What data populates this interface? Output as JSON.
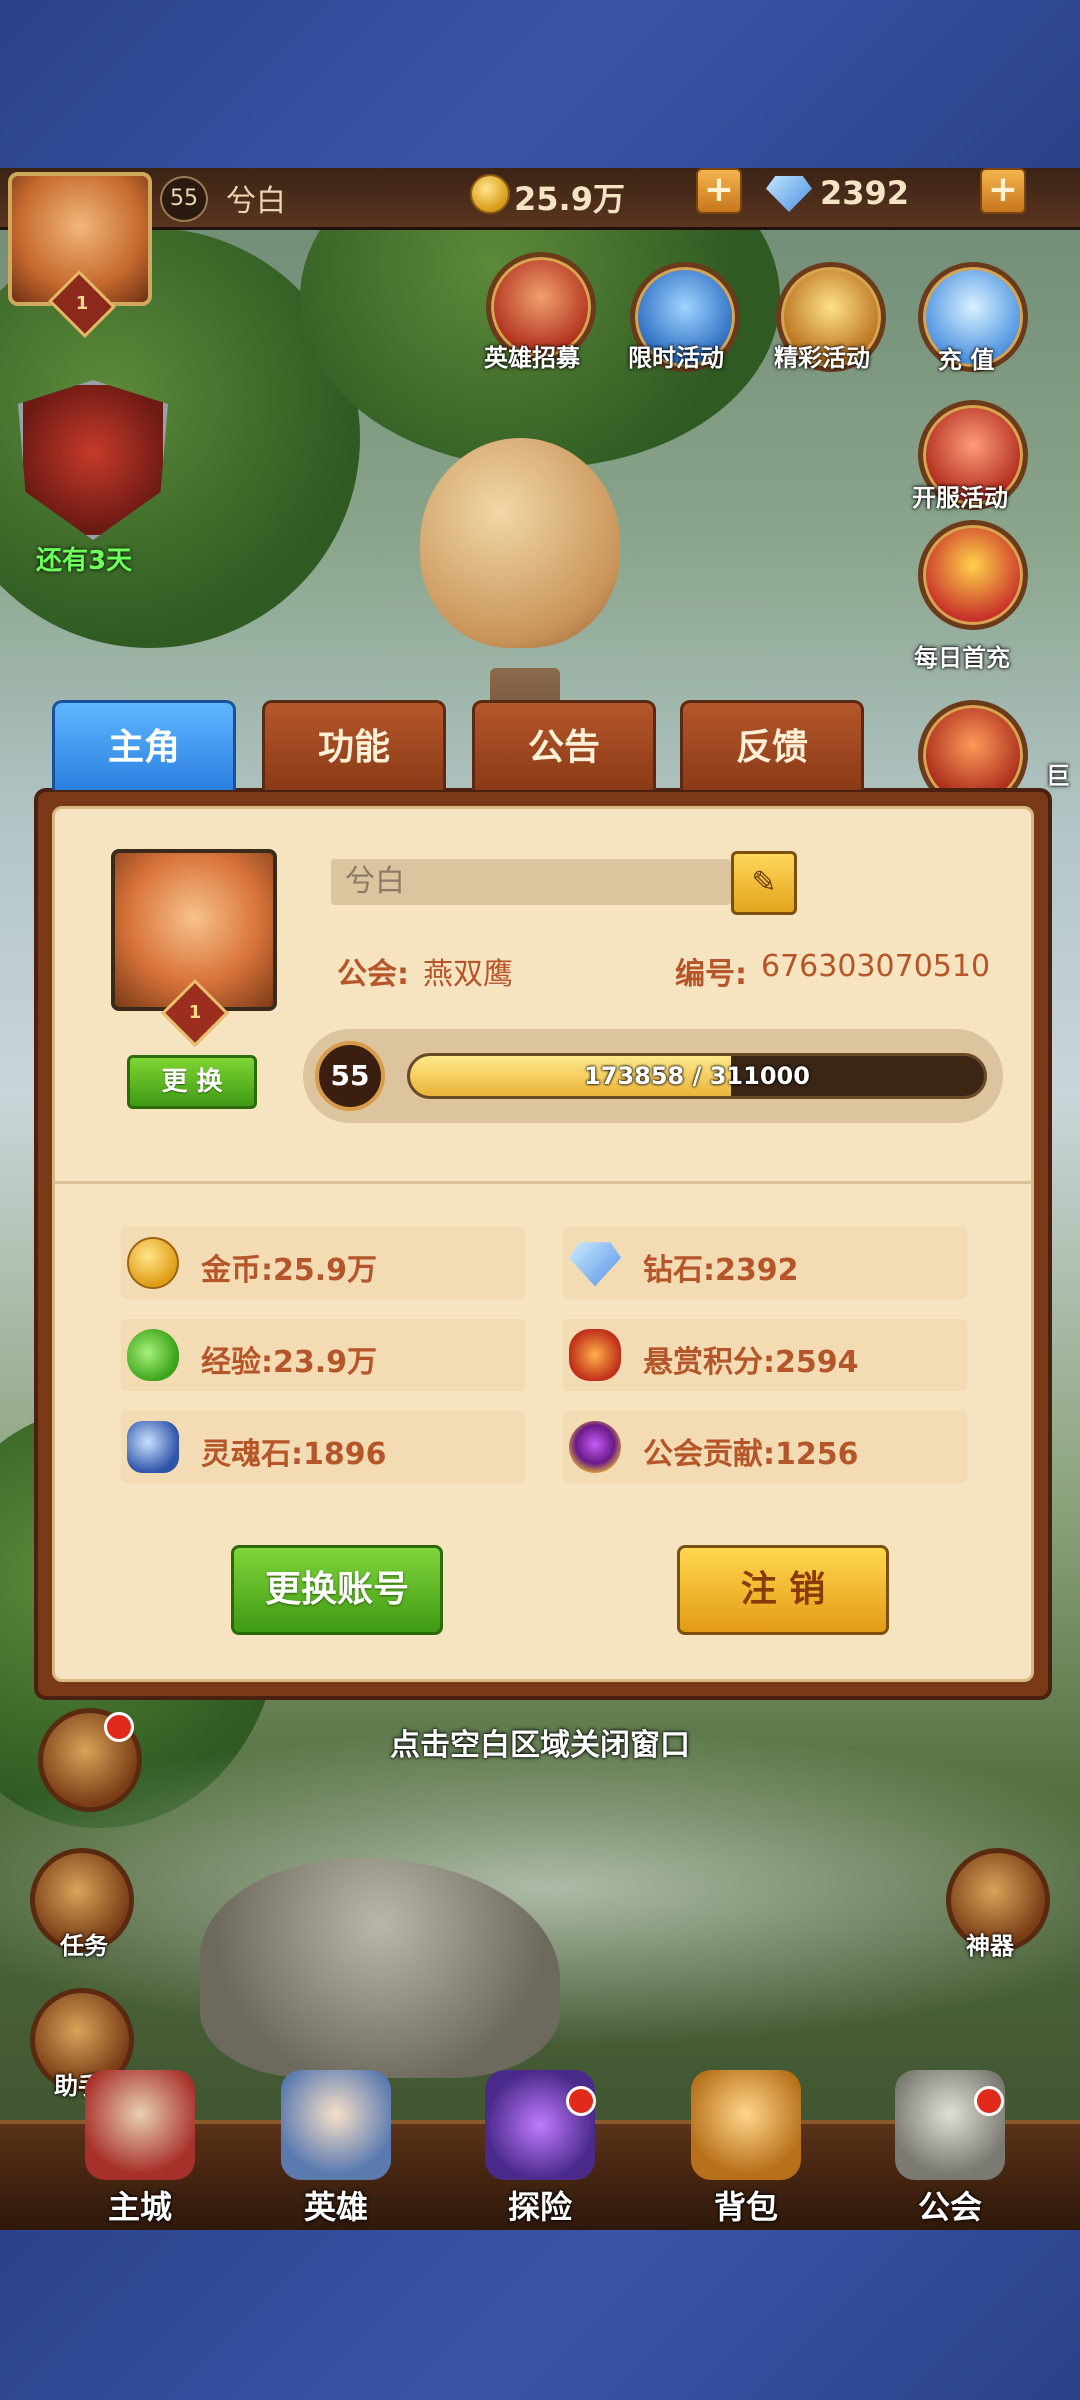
{
  "hud": {
    "level": "55",
    "player_name": "兮白",
    "gold": "25.9万",
    "diamonds": "2392",
    "avatar_rank": "1",
    "plus_symbol": "+"
  },
  "menu_icons": {
    "hero_recruit": "英雄招募",
    "limited_event": "限时活动",
    "featured_event": "精彩活动",
    "recharge": "充 值",
    "server_event": "开服活动",
    "daily_first_recharge": "每日首充",
    "shield_timer": "还有3天",
    "side_partial": "巨"
  },
  "tabs": [
    "主角",
    "功能",
    "公告",
    "反馈"
  ],
  "profile": {
    "avatar_rank": "1",
    "change_avatar_label": "更 换",
    "name": "兮白",
    "edit_icon": "✎",
    "guild_label": "公会:",
    "guild_value": "燕双鹰",
    "id_label": "编号:",
    "id_value": "676303070510",
    "level": "55",
    "exp_text": "173858 / 311000",
    "exp_progress": 0.559
  },
  "stats": [
    {
      "label": "金币:",
      "value": "25.9万",
      "icon": "coin-icon"
    },
    {
      "label": "钻石:",
      "value": "2392",
      "icon": "diamond-icon"
    },
    {
      "label": "经验:",
      "value": "23.9万",
      "icon": "potion-icon"
    },
    {
      "label": "悬赏积分:",
      "value": "2594",
      "icon": "bounty-icon"
    },
    {
      "label": "灵魂石:",
      "value": "1896",
      "icon": "soulstone-icon"
    },
    {
      "label": "公会贡献:",
      "value": "1256",
      "icon": "guild-contribution-icon"
    }
  ],
  "buttons": {
    "switch_account": "更换账号",
    "logout": "注 销"
  },
  "hint": "点击空白区域关闭窗口",
  "side_buttons": {
    "task": "任务",
    "helper": "助手",
    "artifact": "神器"
  },
  "bottom_nav": [
    "主城",
    "英雄",
    "探险",
    "背包",
    "公会"
  ],
  "colors": {
    "accent_text": "#b5562a",
    "panel_bg": "#f6e3c0",
    "tab_active": "#2b7fe0",
    "tab_inactive": "#8a3a17"
  }
}
